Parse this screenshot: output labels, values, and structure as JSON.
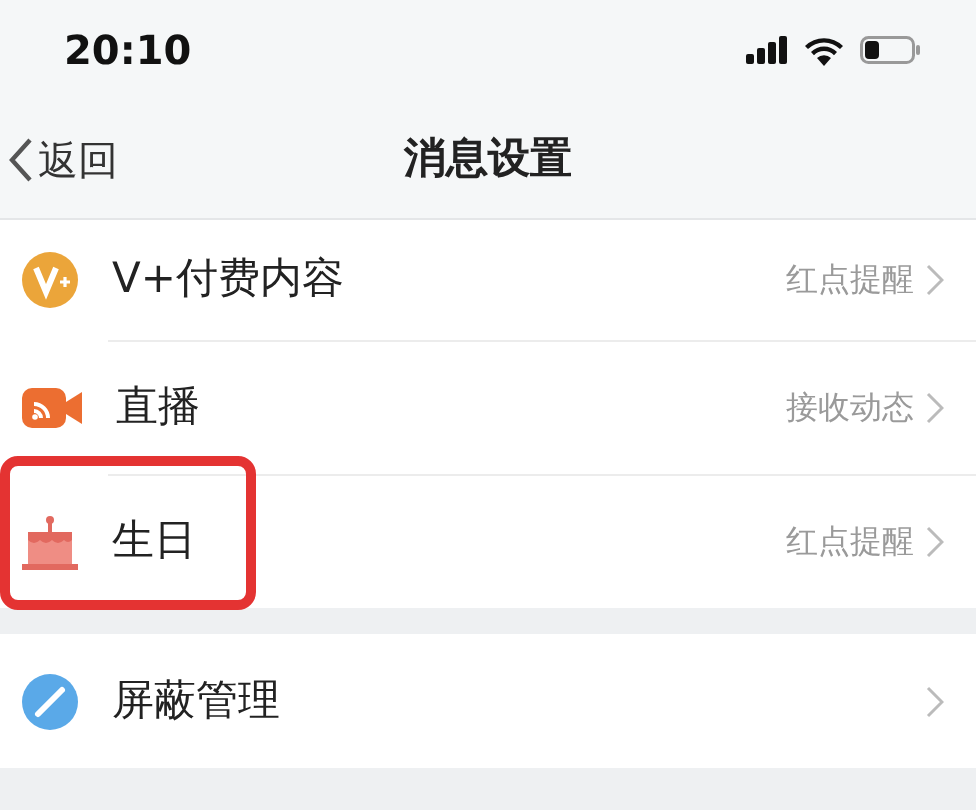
{
  "status_bar": {
    "time": "20:10"
  },
  "nav": {
    "back": "返回",
    "title": "消息设置"
  },
  "sections": [
    {
      "rows": [
        {
          "label": "V+付费内容",
          "value": "红点提醒",
          "highlighted": false
        },
        {
          "label": "直播",
          "value": "接收动态",
          "highlighted": false
        },
        {
          "label": "生日",
          "value": "红点提醒",
          "highlighted": true
        }
      ]
    },
    {
      "rows": [
        {
          "label": "屏蔽管理",
          "highlighted": false
        }
      ]
    }
  ]
}
